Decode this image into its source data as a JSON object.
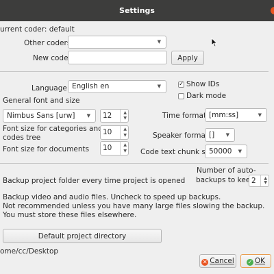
{
  "window": {
    "title": "Settings"
  },
  "current_coder": "urrent coder: default",
  "other_coders": {
    "label": "Other coders",
    "value": ""
  },
  "new_coder": {
    "label": "New coder",
    "value": "",
    "apply_label": "Apply"
  },
  "language": {
    "label": "Language",
    "value": "English en"
  },
  "show_ids": {
    "label": "Show IDs",
    "checked": true
  },
  "dark_mode": {
    "label": "Dark mode",
    "checked": false
  },
  "font_section": {
    "label": "General font and size"
  },
  "font": {
    "family": "Nimbus Sans [urw]",
    "size": "12"
  },
  "time_format": {
    "label": "Time format",
    "value": "[mm:ss]"
  },
  "category_font": {
    "label_line1": "Font size for categories and",
    "label_line2": "codes tree",
    "value": "10"
  },
  "speaker_format": {
    "label": "Speaker format",
    "value": "[]"
  },
  "doc_font": {
    "label": "Font size for documents",
    "value": "10"
  },
  "chunk_size": {
    "label": "Code text chunk size",
    "value": "50000"
  },
  "backups": {
    "number_label_line1": "Number of auto-",
    "number_label_line2": "backups to keep",
    "number_value": "2",
    "folder_label": "Backup project folder every time project is opened",
    "av_line1": "Backup video and audio files. Uncheck to speed up backups.",
    "av_line2": "Not recommended unless you have many large files slowing the backup.",
    "av_line3": "You must store these files elsewhere."
  },
  "default_dir": {
    "button_label": "Default project directory",
    "path": "ome/cc/Desktop"
  },
  "footer": {
    "cancel_label": "Cancel",
    "ok_label": "OK"
  },
  "colors": {
    "accent": "#e95420",
    "titlebar": "#3d3d3c",
    "ok_border": "#e99d4e",
    "ok_icon": "#4caf50"
  }
}
